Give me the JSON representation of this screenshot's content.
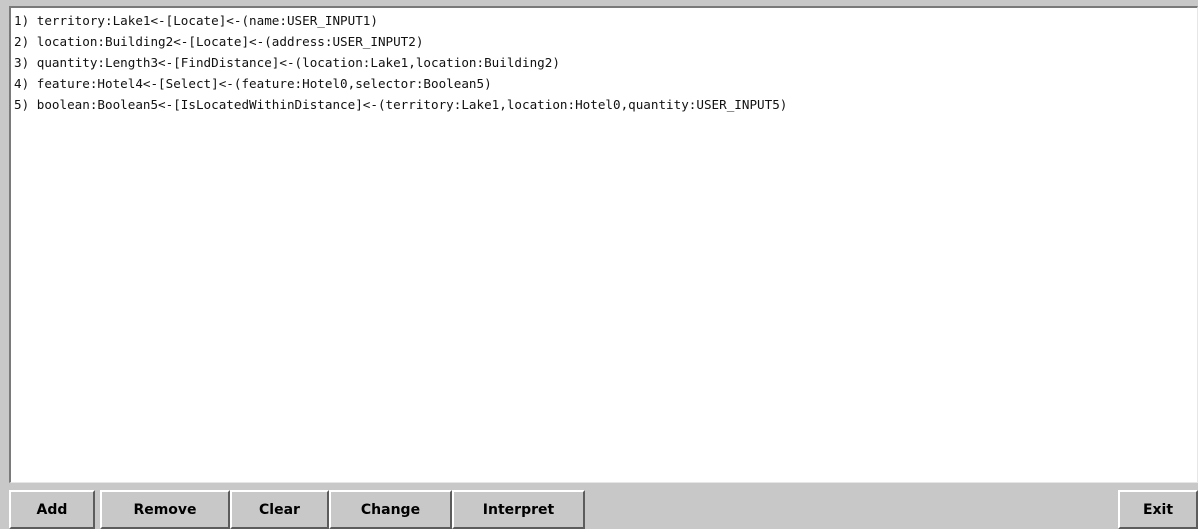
{
  "query_lines": [
    "1) territory:Lake1<-[Locate]<-(name:USER_INPUT1)",
    "2) location:Building2<-[Locate]<-(address:USER_INPUT2)",
    "3) quantity:Length3<-[FindDistance]<-(location:Lake1,location:Building2)",
    "4) feature:Hotel4<-[Select]<-(feature:Hotel0,selector:Boolean5)",
    "5) boolean:Boolean5<-[IsLocatedWithinDistance]<-(territory:Lake1,location:Hotel0,quantity:USER_INPUT5)"
  ],
  "buttons": {
    "add": "Add",
    "remove": "Remove",
    "clear": "Clear",
    "change": "Change",
    "interpret": "Interpret",
    "exit": "Exit"
  }
}
